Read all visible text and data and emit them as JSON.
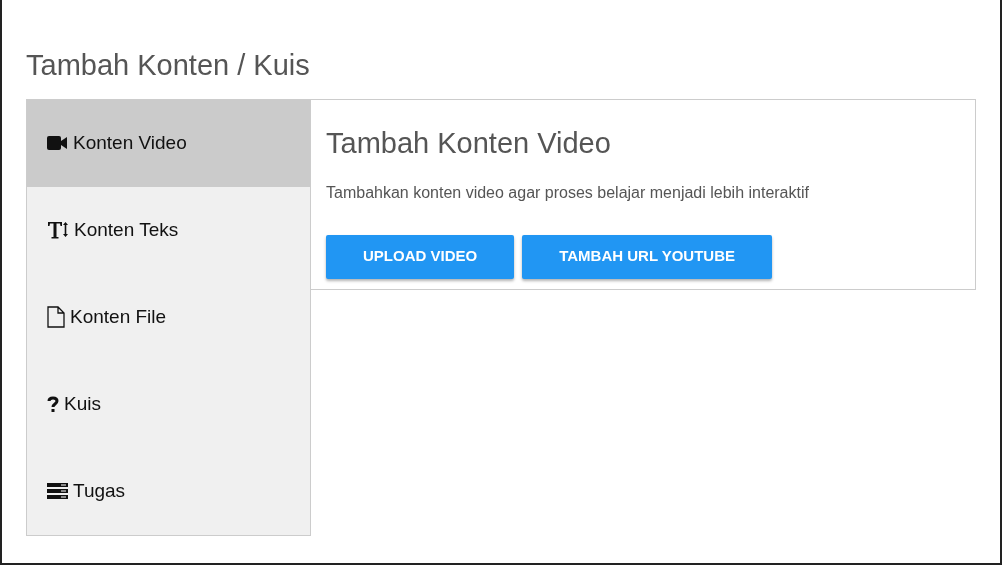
{
  "dialog": {
    "title": "Tambah Konten / Kuis"
  },
  "sidebar": {
    "items": [
      {
        "kind": "video",
        "label": "Konten Video",
        "selected": true
      },
      {
        "kind": "text",
        "label": "Konten Teks",
        "selected": false
      },
      {
        "kind": "file",
        "label": "Konten File",
        "selected": false
      },
      {
        "kind": "quiz",
        "label": "Kuis",
        "selected": false
      },
      {
        "kind": "task",
        "label": "Tugas",
        "selected": false
      }
    ]
  },
  "panel": {
    "heading": "Tambah Konten Video",
    "description": "Tambahkan konten video agar proses belajar menjadi lebih interaktif",
    "buttons": [
      "UPLOAD VIDEO",
      "TAMBAH URL YOUTUBE"
    ]
  }
}
